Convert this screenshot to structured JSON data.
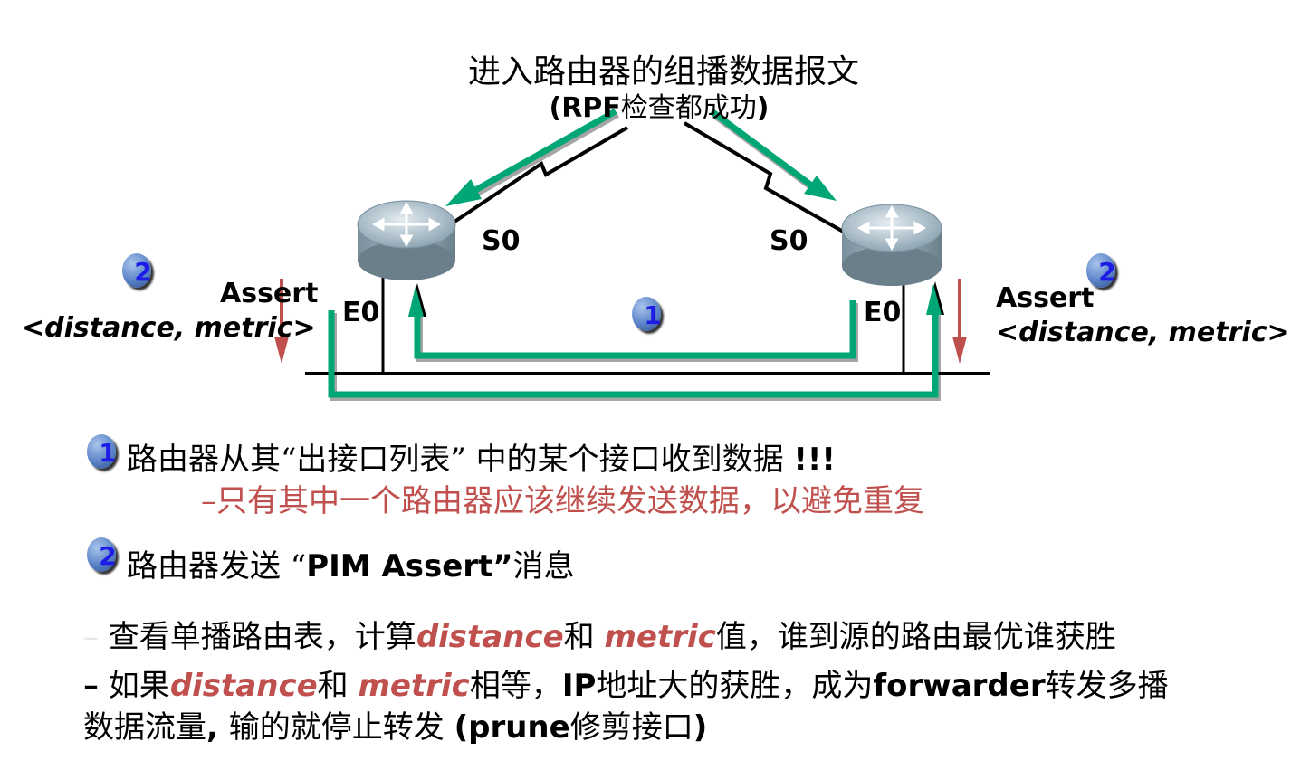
{
  "diagram": {
    "title": "进入路由器的组播数据报文",
    "subtitle_rpf": "RPF",
    "subtitle_text": "检查都成功",
    "left_router": {
      "serial_label": "S0",
      "ethernet_label": "E0"
    },
    "right_router": {
      "serial_label": "S0",
      "ethernet_label": "E0"
    },
    "left_assert": {
      "title": "Assert",
      "params": "<distance, metric>",
      "step": "2"
    },
    "right_assert": {
      "title": "Assert",
      "params": "<distance, metric>",
      "step": "2"
    },
    "center_step": "1"
  },
  "notes": {
    "step1": {
      "badge": "1",
      "text": "路由器从其“出接口列表” 中的某个接口收到数据",
      "emphasis": "!!!",
      "sub": "–只有其中一个路由器应该继续发送数据，以避免重复"
    },
    "step2": {
      "badge": "2",
      "text_a": "路由器发送 “",
      "text_b": "PIM Assert”",
      "text_c": "消息"
    },
    "bullet1": {
      "dash": "–",
      "a": " 查看单播路由表，计算",
      "b": "distance",
      "c": "和 ",
      "d": "metric",
      "e": "值，谁到源的路由最优谁获胜"
    },
    "bullet2": {
      "dash": "–",
      "a": " 如果",
      "b": "distance",
      "c": "和 ",
      "d": "metric",
      "e": "相等，",
      "f": "IP",
      "g": "地址大的获胜，成为",
      "h": "forwarder",
      "i": "转发多播",
      "line2_a": "数据流量",
      "line2_b": ", ",
      "line2_c": "输的就停止转发 ",
      "line2_d": "(prune",
      "line2_e": "修剪接口",
      "line2_f": ")"
    }
  },
  "colors": {
    "arrow_green": "#00a676",
    "assert_red": "#c0504d",
    "badge_blue": "#1c1ce6"
  }
}
